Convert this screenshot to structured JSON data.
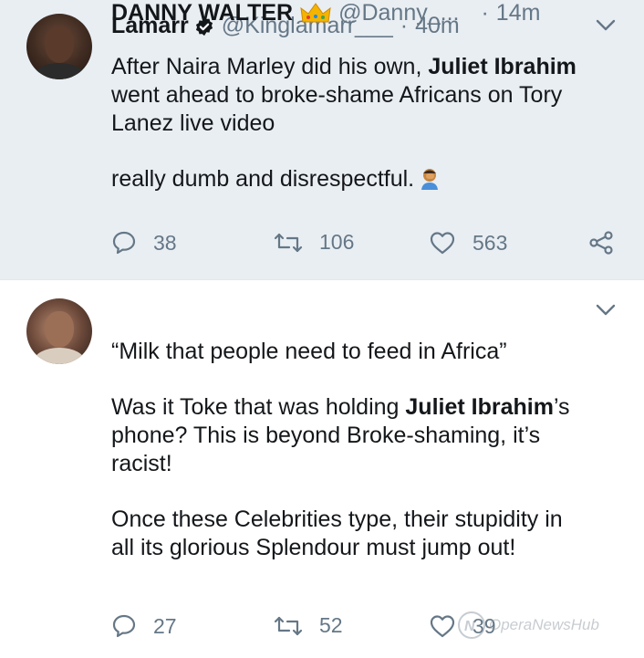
{
  "tweets": [
    {
      "name": "Lamarr",
      "handle": "@Kinglamarr___",
      "dot": "·",
      "time": "40m",
      "text_parts": {
        "l1a": "After Naira Marley did his own, ",
        "l1b": "Juliet Ibrahim",
        "l2": "went ahead to broke-shame Africans on Tory",
        "l3": "Lanez live video",
        "l4": "really dumb and disrespectful."
      },
      "replies": "38",
      "retweets": "106",
      "likes": "563"
    },
    {
      "name": "DANNY WALTER",
      "handle": "@Danny_...",
      "dot": "·",
      "time": "14m",
      "text_parts": {
        "l1": "“Milk that people need to feed in Africa”",
        "l2a": "Was it Toke that was holding ",
        "l2b": "Juliet Ibrahim",
        "l2c": "’s",
        "l3": "phone? This is beyond Broke-shaming, it’s",
        "l4": "racist!",
        "l5": "Once these Celebrities type, their stupidity in",
        "l6": "all its glorious Splendour must jump out!"
      },
      "replies": "27",
      "retweets": "52",
      "likes": "39"
    }
  ],
  "watermark": "OperaNewsHub",
  "colors": {
    "tweet1_bg": "#e9eef3",
    "text": "#14171a",
    "secondary": "#657786",
    "icon": "#657786"
  }
}
